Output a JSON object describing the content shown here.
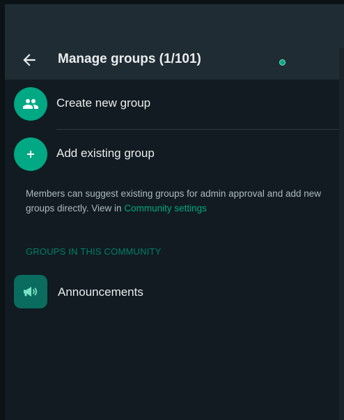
{
  "header": {
    "title": "Manage groups (1/101)",
    "back_icon": "arrow-left-icon"
  },
  "actions": [
    {
      "label": "Create new group",
      "icon": "people-icon"
    },
    {
      "label": "Add existing group",
      "icon": "plus-icon"
    }
  ],
  "info": {
    "text": "Members can suggest existing groups for admin approval and add new groups directly. View in ",
    "link": "Community settings"
  },
  "section": {
    "heading": "GROUPS IN THIS COMMUNITY"
  },
  "groups": [
    {
      "name": "Announcements",
      "icon": "megaphone-icon"
    }
  ],
  "colors": {
    "accent": "#00a884",
    "panel": "#111b21",
    "header": "#202c33",
    "text_primary": "#e9edef",
    "text_secondary": "#aebac1",
    "section_heading": "#008069",
    "announcement_avatar": "#0a6c5e"
  }
}
